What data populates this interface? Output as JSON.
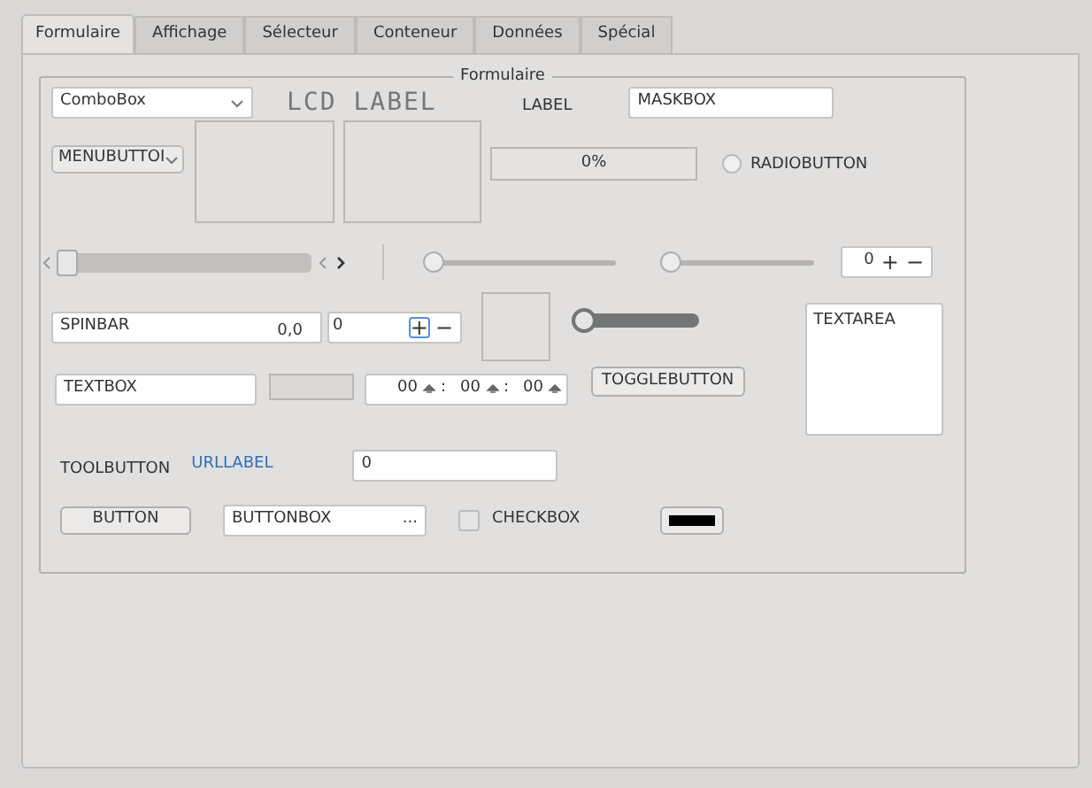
{
  "tabs": [
    {
      "label": "Formulaire",
      "selected": true
    },
    {
      "label": "Affichage",
      "selected": false
    },
    {
      "label": "Sélecteur",
      "selected": false
    },
    {
      "label": "Conteneur",
      "selected": false
    },
    {
      "label": "Données",
      "selected": false
    },
    {
      "label": "Spécial",
      "selected": false
    }
  ],
  "group": {
    "title": "Formulaire"
  },
  "combobox": {
    "value": "ComboBox"
  },
  "lcd_label": {
    "text": "LCD LABEL"
  },
  "label": {
    "text": "LABEL"
  },
  "maskbox": {
    "value": "MASKBOX"
  },
  "menubutton": {
    "label": "MENUBUTTOI"
  },
  "progress": {
    "text": "0%",
    "level": 0
  },
  "radio": {
    "label": "RADIOBUTTON",
    "selected": false
  },
  "scrollbar": {
    "level": 0
  },
  "sliders": [
    {
      "level": 0
    },
    {
      "level": 0
    }
  ],
  "spinbox_small": {
    "value": "0",
    "plus": "+",
    "minus": "−"
  },
  "spinbar": {
    "label": "SPINBAR",
    "value": "0,0"
  },
  "spinbox": {
    "value": "0",
    "plus": "+",
    "minus": "−"
  },
  "switch": {
    "on": false
  },
  "textarea": {
    "value": "TEXTAREA"
  },
  "textbox": {
    "value": "TEXTBOX"
  },
  "time": {
    "fields": [
      "00",
      "00",
      "00"
    ],
    "separator": ":"
  },
  "togglebutton": {
    "label": "TOGGLEBUTTON",
    "on": false
  },
  "toolbutton": {
    "label": "TOOLBUTTON"
  },
  "urllabel": {
    "text": "URLLABEL"
  },
  "valuebox": {
    "value": "0"
  },
  "button": {
    "label": "BUTTON"
  },
  "buttonbox": {
    "value": "BUTTONBOX",
    "action": "..."
  },
  "checkbox": {
    "label": "CHECKBOX",
    "checked": false
  },
  "colorbutton": {
    "color": "#000000"
  }
}
